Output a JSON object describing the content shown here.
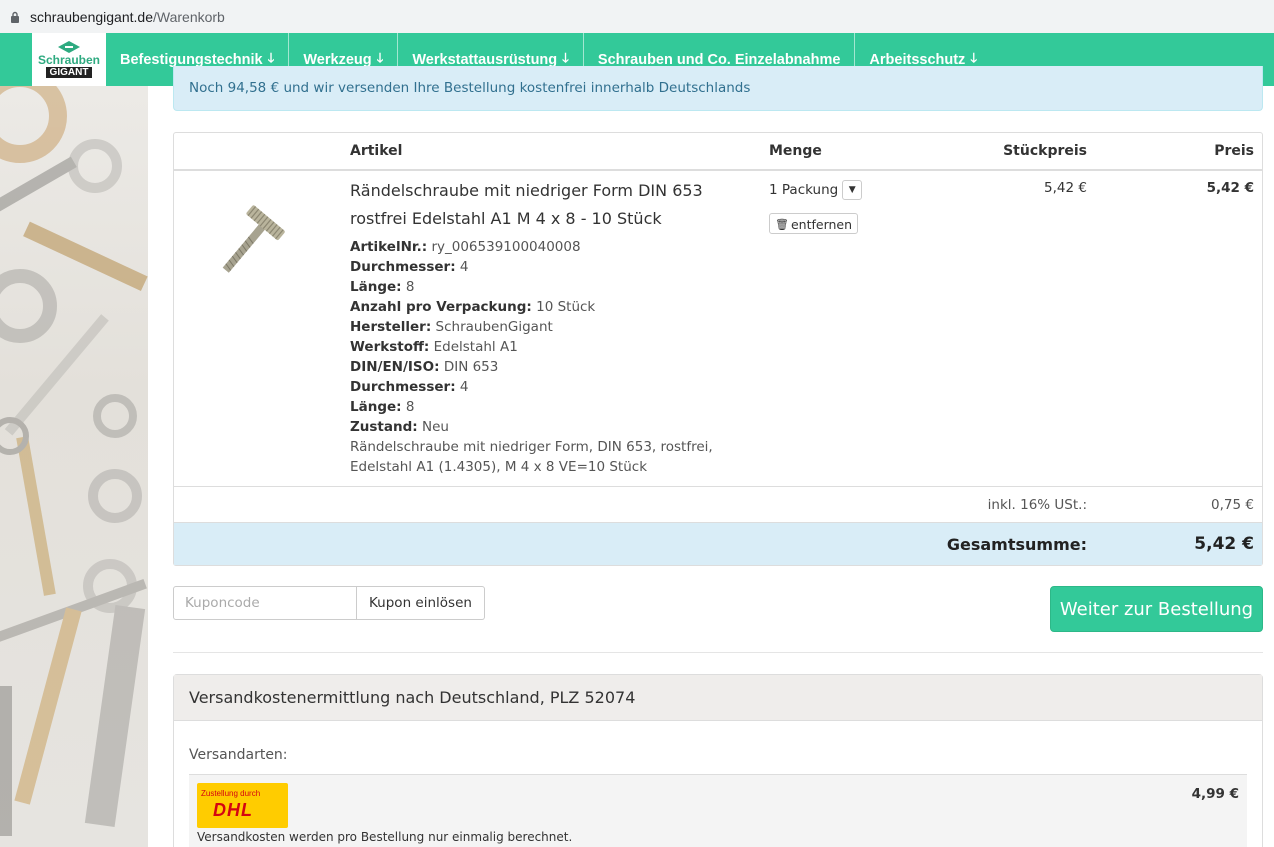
{
  "browser": {
    "domain": "schraubengigant.de",
    "path": "/Warenkorb"
  },
  "logo": {
    "line1": "Schrauben",
    "line2": "GIGANT"
  },
  "nav": {
    "items": [
      {
        "label": "Befestigungstechnik",
        "has_arrow": true
      },
      {
        "label": "Werkzeug",
        "has_arrow": true
      },
      {
        "label": "Werkstattausrüstung",
        "has_arrow": true
      },
      {
        "label": "Schrauben und Co. Einzelabnahme",
        "has_arrow": false
      },
      {
        "label": "Arbeitsschutz",
        "has_arrow": true
      }
    ],
    "arrow_glyph": "🡓"
  },
  "banner": {
    "text": "Noch 94,58 € und wir versenden Ihre Bestellung kostenfrei innerhalb Deutschlands"
  },
  "table": {
    "headers": {
      "article": "Artikel",
      "qty": "Menge",
      "unit_price": "Stückpreis",
      "price": "Preis"
    }
  },
  "item": {
    "title": "Rändelschraube mit niedriger Form DIN 653 rostfrei Edelstahl A1 M 4 x 8 - 10 Stück",
    "attributes": [
      {
        "label": "ArtikelNr.:",
        "value": "ry_006539100040008"
      },
      {
        "label": "Durchmesser:",
        "value": "4"
      },
      {
        "label": "Länge:",
        "value": "8"
      },
      {
        "label": "Anzahl pro Verpackung:",
        "value": "10 Stück"
      },
      {
        "label": "Hersteller:",
        "value": "SchraubenGigant"
      },
      {
        "label": "Werkstoff:",
        "value": "Edelstahl A1"
      },
      {
        "label": "DIN/EN/ISO:",
        "value": "DIN 653"
      },
      {
        "label": "Durchmesser:",
        "value": "4"
      },
      {
        "label": "Länge:",
        "value": "8"
      },
      {
        "label": "Zustand:",
        "value": "Neu"
      }
    ],
    "description": "Rändelschraube mit niedriger Form, DIN 653, rostfrei, Edelstahl A1 (1.4305), M 4 x 8 VE=10 Stück",
    "qty": "1 Packung",
    "remove_label": "entfernen",
    "unit_price": "5,42 €",
    "price": "5,42 €"
  },
  "tax": {
    "label": "inkl. 16% USt.:",
    "value": "0,75 €"
  },
  "total": {
    "label": "Gesamtsumme:",
    "value": "5,42 €"
  },
  "coupon": {
    "placeholder": "Kuponcode",
    "button": "Kupon einlösen"
  },
  "checkout_label": "Weiter zur Bestellung",
  "shipping": {
    "title": "Versandkostenermittlung nach Deutschland, PLZ 52074",
    "methods_label": "Versandarten:",
    "option": {
      "carrier_top": "Zustellung durch",
      "carrier_logo": "DHL",
      "note": "Versandkosten werden pro Bestellung nur einmalig berechnet.",
      "cost": "4,99 €"
    }
  },
  "colors": {
    "accent": "#33c999",
    "info_bg": "#d9edf7",
    "info_text": "#31708f",
    "dhl_yellow": "#ffcc00",
    "dhl_red": "#d40511"
  }
}
